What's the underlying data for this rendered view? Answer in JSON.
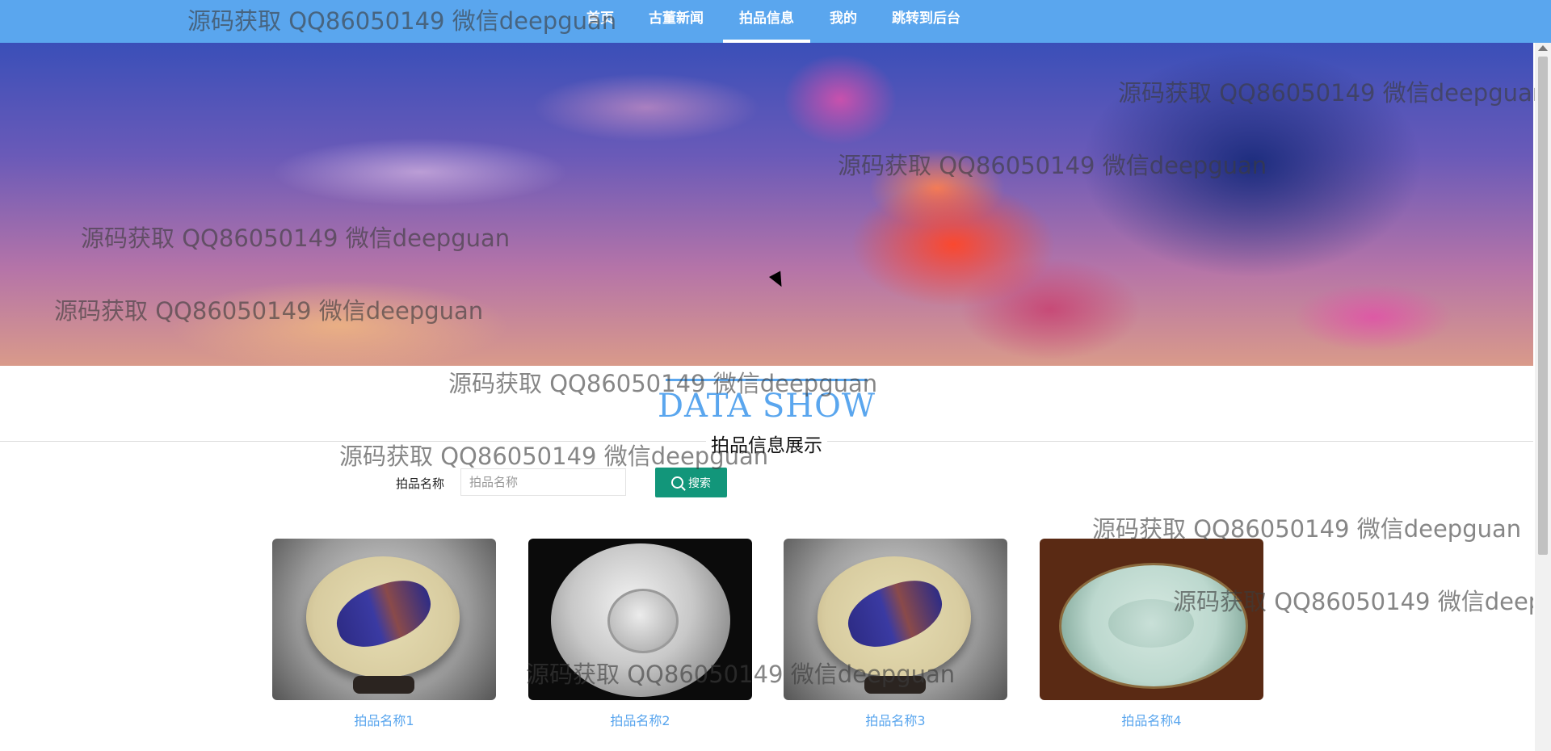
{
  "nav": {
    "items": [
      {
        "label": "首页",
        "active": false
      },
      {
        "label": "古董新闻",
        "active": false
      },
      {
        "label": "拍品信息",
        "active": true
      },
      {
        "label": "我的",
        "active": false
      },
      {
        "label": "跳转到后台",
        "active": false
      }
    ]
  },
  "section": {
    "title": "DATA SHOW",
    "subtitle": "拍品信息展示"
  },
  "search": {
    "label": "拍品名称",
    "placeholder": "拍品名称",
    "value": "",
    "button_label": "搜索"
  },
  "items": [
    {
      "name": "拍品名称1"
    },
    {
      "name": "拍品名称2"
    },
    {
      "name": "拍品名称3"
    },
    {
      "name": "拍品名称4"
    }
  ],
  "watermark": "源码获取 QQ86050149 微信deepguan",
  "colors": {
    "accent": "#5aa6ee",
    "search_button": "#12967a"
  }
}
